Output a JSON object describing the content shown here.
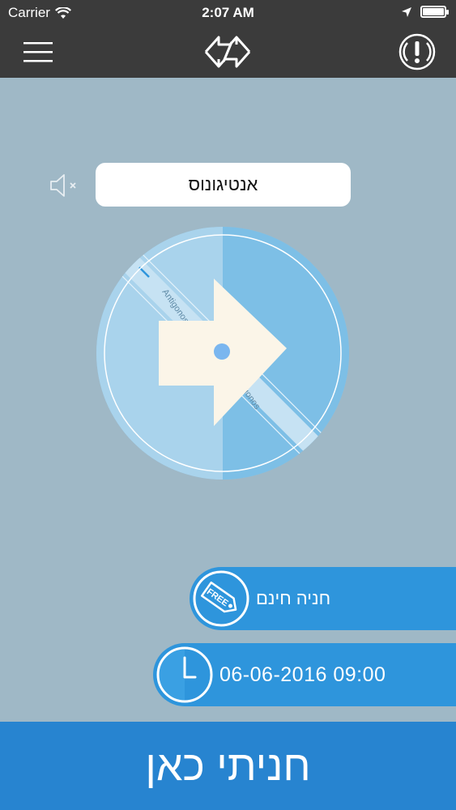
{
  "status_bar": {
    "carrier": "Carrier",
    "time": "2:07 AM",
    "battery_percent": 100
  },
  "nav": {
    "menu_icon": "hamburger-menu-icon",
    "logo_icon": "swap-arrows-icon",
    "alert_icon": "exclamation-circle-icon"
  },
  "street": {
    "name": "אנטיגונוס",
    "mute_icon": "speaker-muted-icon"
  },
  "map": {
    "street_label_1": "Antigonos",
    "street_label_2": "Antigonos"
  },
  "info": {
    "parking_type": "חניה חינם",
    "free_badge": "FREE",
    "datetime": "06-06-2016 09:00"
  },
  "action": {
    "parked_here": "חניתי כאן"
  },
  "colors": {
    "bar_dark": "#3b3b3b",
    "background": "#9fb8c6",
    "accent_blue": "#2e95dc",
    "bottom_blue": "#2784d0"
  }
}
